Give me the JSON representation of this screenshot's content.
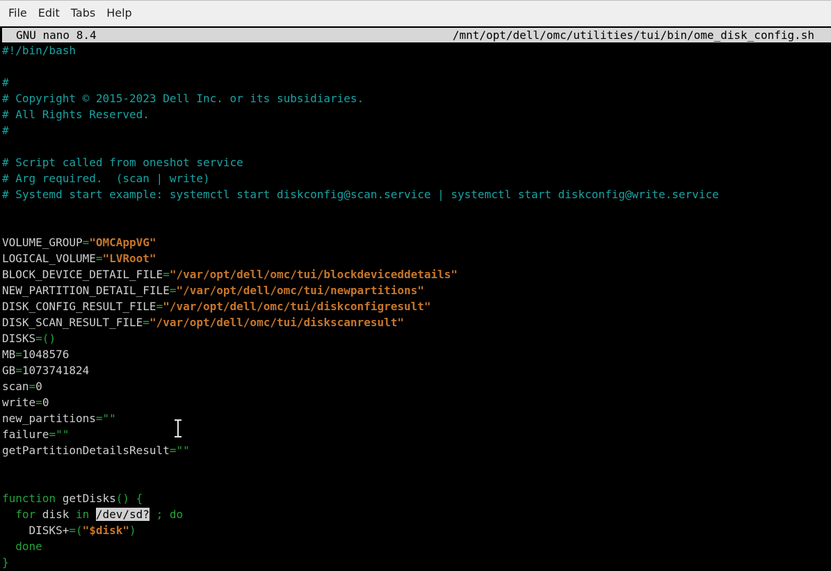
{
  "menu": [
    "File",
    "Edit",
    "Tabs",
    "Help"
  ],
  "nano": {
    "version_label": "GNU nano 8.4",
    "file_path": "/mnt/opt/dell/omc/utilities/tui/bin/ome_disk_config.sh"
  },
  "colors": {
    "comment": "#19a3a3",
    "keyword": "#23a33a",
    "string": "#c8762a",
    "text": "#d0d0d0",
    "background": "#000000",
    "titlebar": "#d7d7d7"
  },
  "code": [
    [
      [
        "#!/bin/bash",
        "comment"
      ]
    ],
    [],
    [
      [
        "#",
        "comment"
      ]
    ],
    [
      [
        "# Copyright © 2015-2023 Dell Inc. or its subsidiaries.",
        "comment"
      ]
    ],
    [
      [
        "# All Rights Reserved.",
        "comment"
      ]
    ],
    [
      [
        "#",
        "comment"
      ]
    ],
    [],
    [
      [
        "# Script called from oneshot service",
        "comment"
      ]
    ],
    [
      [
        "# Arg required.  (scan | write)",
        "comment"
      ]
    ],
    [
      [
        "# Systemd start example: systemctl start diskconfig@scan.service | systemctl start diskconfig@write.service",
        "comment"
      ]
    ],
    [],
    [],
    [
      [
        "VOLUME_GROUP",
        "text"
      ],
      [
        "=",
        "green"
      ],
      [
        "\"OMCAppVG\"",
        "string"
      ]
    ],
    [
      [
        "LOGICAL_VOLUME",
        "text"
      ],
      [
        "=",
        "green"
      ],
      [
        "\"LVRoot\"",
        "string"
      ]
    ],
    [
      [
        "BLOCK_DEVICE_DETAIL_FILE",
        "text"
      ],
      [
        "=",
        "green"
      ],
      [
        "\"/var/opt/dell/omc/tui/blockdeviceddetails\"",
        "string"
      ]
    ],
    [
      [
        "NEW_PARTITION_DETAIL_FILE",
        "text"
      ],
      [
        "=",
        "green"
      ],
      [
        "\"/var/opt/dell/omc/tui/newpartitions\"",
        "string"
      ]
    ],
    [
      [
        "DISK_CONFIG_RESULT_FILE",
        "text"
      ],
      [
        "=",
        "green"
      ],
      [
        "\"/var/opt/dell/omc/tui/diskconfigresult\"",
        "string"
      ]
    ],
    [
      [
        "DISK_SCAN_RESULT_FILE",
        "text"
      ],
      [
        "=",
        "green"
      ],
      [
        "\"/var/opt/dell/omc/tui/diskscanresult\"",
        "string"
      ]
    ],
    [
      [
        "DISKS",
        "text"
      ],
      [
        "=()",
        "green"
      ]
    ],
    [
      [
        "MB",
        "text"
      ],
      [
        "=",
        "green"
      ],
      [
        "1048576",
        "text"
      ]
    ],
    [
      [
        "GB",
        "text"
      ],
      [
        "=",
        "green"
      ],
      [
        "1073741824",
        "text"
      ]
    ],
    [
      [
        "scan",
        "text"
      ],
      [
        "=",
        "green"
      ],
      [
        "0",
        "text"
      ]
    ],
    [
      [
        "write",
        "text"
      ],
      [
        "=",
        "green"
      ],
      [
        "0",
        "text"
      ]
    ],
    [
      [
        "new_partitions",
        "text"
      ],
      [
        "=\"\"",
        "green"
      ]
    ],
    [
      [
        "failure",
        "text"
      ],
      [
        "=\"\"",
        "green"
      ]
    ],
    [
      [
        "getPartitionDetailsResult",
        "text"
      ],
      [
        "=\"\"",
        "green"
      ]
    ],
    [],
    [],
    [
      [
        "function",
        "green"
      ],
      [
        " getDisks",
        "text"
      ],
      [
        "() {",
        "green"
      ]
    ],
    [
      [
        "  for",
        "green"
      ],
      [
        " disk ",
        "text"
      ],
      [
        "in",
        "green"
      ],
      [
        " ",
        "text"
      ],
      [
        "/dev/sd?",
        "sel"
      ],
      [
        " ; do",
        "green"
      ]
    ],
    [
      [
        "    DISKS+",
        "text"
      ],
      [
        "=(",
        "green"
      ],
      [
        "\"$disk\"",
        "string"
      ],
      [
        ")",
        "green"
      ]
    ],
    [
      [
        "  done",
        "green"
      ]
    ],
    [
      [
        "}",
        "green"
      ]
    ]
  ]
}
